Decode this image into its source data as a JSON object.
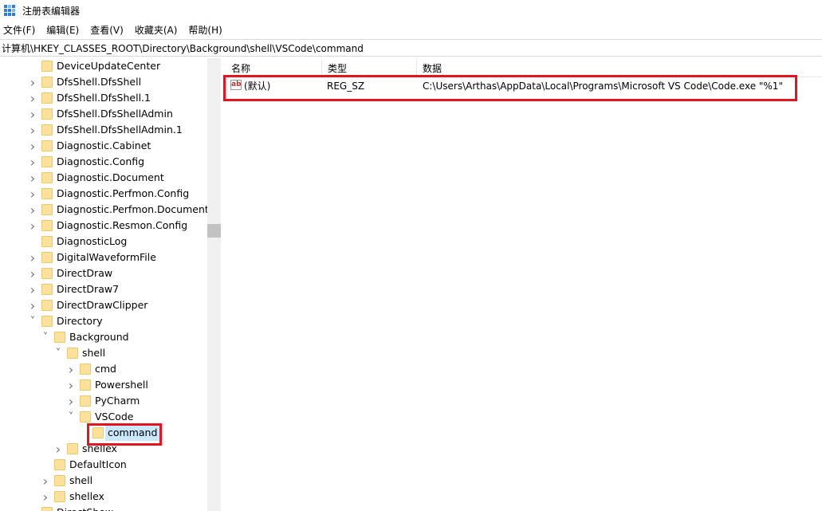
{
  "window": {
    "title": "注册表编辑器"
  },
  "menu": [
    "文件(F)",
    "编辑(E)",
    "查看(V)",
    "收藏夹(A)",
    "帮助(H)"
  ],
  "address": "计算机\\HKEY_CLASSES_ROOT\\Directory\\Background\\shell\\VSCode\\command",
  "tree": [
    {
      "label": "DeviceUpdateCenter",
      "level": 0,
      "chevron": ""
    },
    {
      "label": "DfsShell.DfsShell",
      "level": 0,
      "chevron": "collapsed"
    },
    {
      "label": "DfsShell.DfsShell.1",
      "level": 0,
      "chevron": "collapsed"
    },
    {
      "label": "DfsShell.DfsShellAdmin",
      "level": 0,
      "chevron": "collapsed"
    },
    {
      "label": "DfsShell.DfsShellAdmin.1",
      "level": 0,
      "chevron": "collapsed"
    },
    {
      "label": "Diagnostic.Cabinet",
      "level": 0,
      "chevron": "collapsed"
    },
    {
      "label": "Diagnostic.Config",
      "level": 0,
      "chevron": "collapsed"
    },
    {
      "label": "Diagnostic.Document",
      "level": 0,
      "chevron": "collapsed"
    },
    {
      "label": "Diagnostic.Perfmon.Config",
      "level": 0,
      "chevron": "collapsed"
    },
    {
      "label": "Diagnostic.Perfmon.Document",
      "level": 0,
      "chevron": "collapsed"
    },
    {
      "label": "Diagnostic.Resmon.Config",
      "level": 0,
      "chevron": "collapsed"
    },
    {
      "label": "DiagnosticLog",
      "level": 0,
      "chevron": ""
    },
    {
      "label": "DigitalWaveformFile",
      "level": 0,
      "chevron": "collapsed"
    },
    {
      "label": "DirectDraw",
      "level": 0,
      "chevron": "collapsed"
    },
    {
      "label": "DirectDraw7",
      "level": 0,
      "chevron": "collapsed"
    },
    {
      "label": "DirectDrawClipper",
      "level": 0,
      "chevron": "collapsed"
    },
    {
      "label": "Directory",
      "level": 0,
      "chevron": "expanded"
    },
    {
      "label": "Background",
      "level": 1,
      "chevron": "expanded"
    },
    {
      "label": "shell",
      "level": 2,
      "chevron": "expanded"
    },
    {
      "label": "cmd",
      "level": 3,
      "chevron": "collapsed"
    },
    {
      "label": "Powershell",
      "level": 3,
      "chevron": "collapsed"
    },
    {
      "label": "PyCharm",
      "level": 3,
      "chevron": "collapsed"
    },
    {
      "label": "VSCode",
      "level": 3,
      "chevron": "expanded"
    },
    {
      "label": "command",
      "level": 4,
      "chevron": "",
      "selected": true
    },
    {
      "label": "shellex",
      "level": 2,
      "chevron": "collapsed"
    },
    {
      "label": "DefaultIcon",
      "level": 1,
      "chevron": ""
    },
    {
      "label": "shell",
      "level": 1,
      "chevron": "collapsed"
    },
    {
      "label": "shellex",
      "level": 1,
      "chevron": "collapsed"
    },
    {
      "label": "DirectShow",
      "level": 0,
      "chevron": "collapsed"
    }
  ],
  "columns": {
    "name": "名称",
    "type": "类型",
    "data": "数据"
  },
  "values": [
    {
      "name": "(默认)",
      "type": "REG_SZ",
      "data": "C:\\Users\\Arthas\\AppData\\Local\\Programs\\Microsoft VS Code\\Code.exe \"%1\"",
      "icon": "string-value-icon"
    }
  ],
  "colors": {
    "highlight": "#e3141e",
    "selection": "#cce8ff",
    "folder": "#fbe19b"
  }
}
